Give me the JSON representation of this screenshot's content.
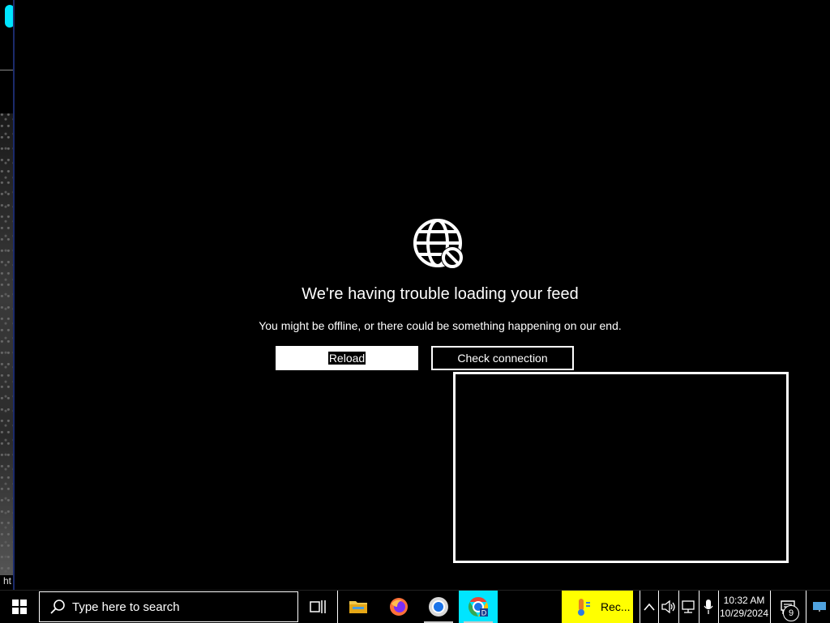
{
  "background": {
    "url_fragment": "ht"
  },
  "error": {
    "icon": "globe-blocked-icon",
    "title": "We're having trouble loading your feed",
    "subtitle": "You might be offline, or there could be something happening on our end.",
    "reload_label": "Reload",
    "check_label": "Check connection"
  },
  "taskbar": {
    "search_placeholder": "Type here to search",
    "pinned": [
      {
        "name": "task-view-icon"
      },
      {
        "name": "file-explorer-icon"
      },
      {
        "name": "firefox-icon"
      },
      {
        "name": "chrome-icon"
      },
      {
        "name": "chrome-profile-icon"
      }
    ],
    "active_app_label": "Rec...",
    "time": "10:32 AM",
    "date": "10/29/2024",
    "notification_count": "9"
  },
  "colors": {
    "accent_highlight": "#ffff00",
    "chrome_active_bg": "#00e5ff"
  }
}
